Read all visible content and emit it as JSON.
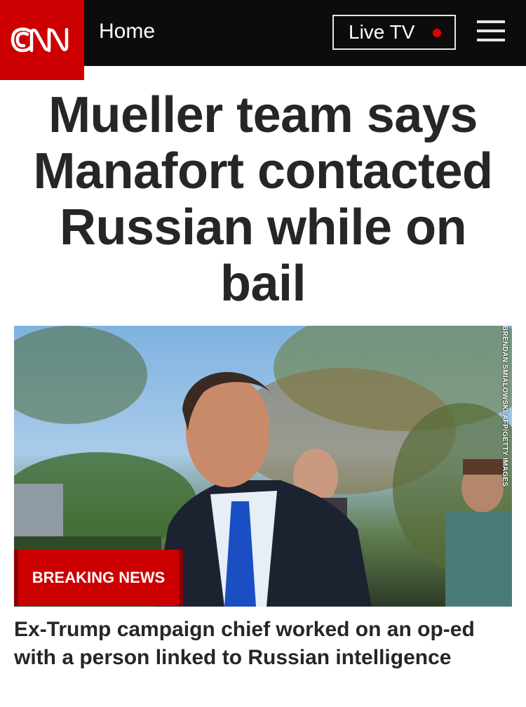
{
  "header": {
    "logo_text": "CNN",
    "home_label": "Home",
    "live_tv_label": "Live TV",
    "menu_icon": "hamburger-menu-icon"
  },
  "article": {
    "headline": "Mueller team says Manafort contacted Russian while on bail",
    "photo_credit": "BRENDAN SMIALOWSKI/AFP/GETTY IMAGES",
    "badge": "BREAKING NEWS",
    "subheadline": "Ex-Trump campaign chief worked on an op-ed with a person linked to Russian intelligence"
  },
  "colors": {
    "brand_red": "#cc0000",
    "header_bg": "#0c0c0c",
    "text": "#262626"
  }
}
